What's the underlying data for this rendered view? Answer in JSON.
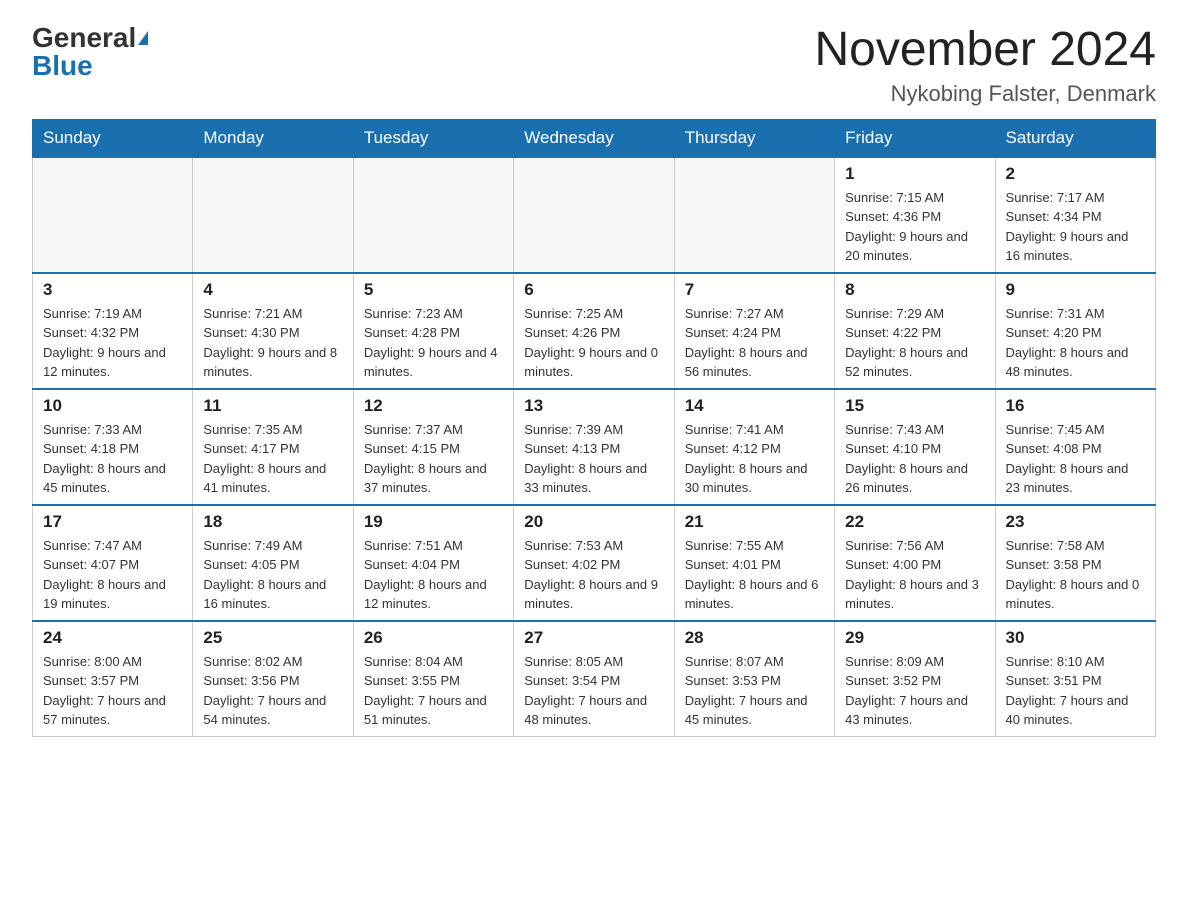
{
  "header": {
    "logo_general": "General",
    "logo_blue": "Blue",
    "month_title": "November 2024",
    "location": "Nykobing Falster, Denmark"
  },
  "weekdays": [
    "Sunday",
    "Monday",
    "Tuesday",
    "Wednesday",
    "Thursday",
    "Friday",
    "Saturday"
  ],
  "weeks": [
    {
      "days": [
        {
          "num": "",
          "empty": true
        },
        {
          "num": "",
          "empty": true
        },
        {
          "num": "",
          "empty": true
        },
        {
          "num": "",
          "empty": true
        },
        {
          "num": "",
          "empty": true
        },
        {
          "num": "1",
          "sunrise": "7:15 AM",
          "sunset": "4:36 PM",
          "daylight": "9 hours and 20 minutes."
        },
        {
          "num": "2",
          "sunrise": "7:17 AM",
          "sunset": "4:34 PM",
          "daylight": "9 hours and 16 minutes."
        }
      ]
    },
    {
      "days": [
        {
          "num": "3",
          "sunrise": "7:19 AM",
          "sunset": "4:32 PM",
          "daylight": "9 hours and 12 minutes."
        },
        {
          "num": "4",
          "sunrise": "7:21 AM",
          "sunset": "4:30 PM",
          "daylight": "9 hours and 8 minutes."
        },
        {
          "num": "5",
          "sunrise": "7:23 AM",
          "sunset": "4:28 PM",
          "daylight": "9 hours and 4 minutes."
        },
        {
          "num": "6",
          "sunrise": "7:25 AM",
          "sunset": "4:26 PM",
          "daylight": "9 hours and 0 minutes."
        },
        {
          "num": "7",
          "sunrise": "7:27 AM",
          "sunset": "4:24 PM",
          "daylight": "8 hours and 56 minutes."
        },
        {
          "num": "8",
          "sunrise": "7:29 AM",
          "sunset": "4:22 PM",
          "daylight": "8 hours and 52 minutes."
        },
        {
          "num": "9",
          "sunrise": "7:31 AM",
          "sunset": "4:20 PM",
          "daylight": "8 hours and 48 minutes."
        }
      ]
    },
    {
      "days": [
        {
          "num": "10",
          "sunrise": "7:33 AM",
          "sunset": "4:18 PM",
          "daylight": "8 hours and 45 minutes."
        },
        {
          "num": "11",
          "sunrise": "7:35 AM",
          "sunset": "4:17 PM",
          "daylight": "8 hours and 41 minutes."
        },
        {
          "num": "12",
          "sunrise": "7:37 AM",
          "sunset": "4:15 PM",
          "daylight": "8 hours and 37 minutes."
        },
        {
          "num": "13",
          "sunrise": "7:39 AM",
          "sunset": "4:13 PM",
          "daylight": "8 hours and 33 minutes."
        },
        {
          "num": "14",
          "sunrise": "7:41 AM",
          "sunset": "4:12 PM",
          "daylight": "8 hours and 30 minutes."
        },
        {
          "num": "15",
          "sunrise": "7:43 AM",
          "sunset": "4:10 PM",
          "daylight": "8 hours and 26 minutes."
        },
        {
          "num": "16",
          "sunrise": "7:45 AM",
          "sunset": "4:08 PM",
          "daylight": "8 hours and 23 minutes."
        }
      ]
    },
    {
      "days": [
        {
          "num": "17",
          "sunrise": "7:47 AM",
          "sunset": "4:07 PM",
          "daylight": "8 hours and 19 minutes."
        },
        {
          "num": "18",
          "sunrise": "7:49 AM",
          "sunset": "4:05 PM",
          "daylight": "8 hours and 16 minutes."
        },
        {
          "num": "19",
          "sunrise": "7:51 AM",
          "sunset": "4:04 PM",
          "daylight": "8 hours and 12 minutes."
        },
        {
          "num": "20",
          "sunrise": "7:53 AM",
          "sunset": "4:02 PM",
          "daylight": "8 hours and 9 minutes."
        },
        {
          "num": "21",
          "sunrise": "7:55 AM",
          "sunset": "4:01 PM",
          "daylight": "8 hours and 6 minutes."
        },
        {
          "num": "22",
          "sunrise": "7:56 AM",
          "sunset": "4:00 PM",
          "daylight": "8 hours and 3 minutes."
        },
        {
          "num": "23",
          "sunrise": "7:58 AM",
          "sunset": "3:58 PM",
          "daylight": "8 hours and 0 minutes."
        }
      ]
    },
    {
      "days": [
        {
          "num": "24",
          "sunrise": "8:00 AM",
          "sunset": "3:57 PM",
          "daylight": "7 hours and 57 minutes."
        },
        {
          "num": "25",
          "sunrise": "8:02 AM",
          "sunset": "3:56 PM",
          "daylight": "7 hours and 54 minutes."
        },
        {
          "num": "26",
          "sunrise": "8:04 AM",
          "sunset": "3:55 PM",
          "daylight": "7 hours and 51 minutes."
        },
        {
          "num": "27",
          "sunrise": "8:05 AM",
          "sunset": "3:54 PM",
          "daylight": "7 hours and 48 minutes."
        },
        {
          "num": "28",
          "sunrise": "8:07 AM",
          "sunset": "3:53 PM",
          "daylight": "7 hours and 45 minutes."
        },
        {
          "num": "29",
          "sunrise": "8:09 AM",
          "sunset": "3:52 PM",
          "daylight": "7 hours and 43 minutes."
        },
        {
          "num": "30",
          "sunrise": "8:10 AM",
          "sunset": "3:51 PM",
          "daylight": "7 hours and 40 minutes."
        }
      ]
    }
  ]
}
